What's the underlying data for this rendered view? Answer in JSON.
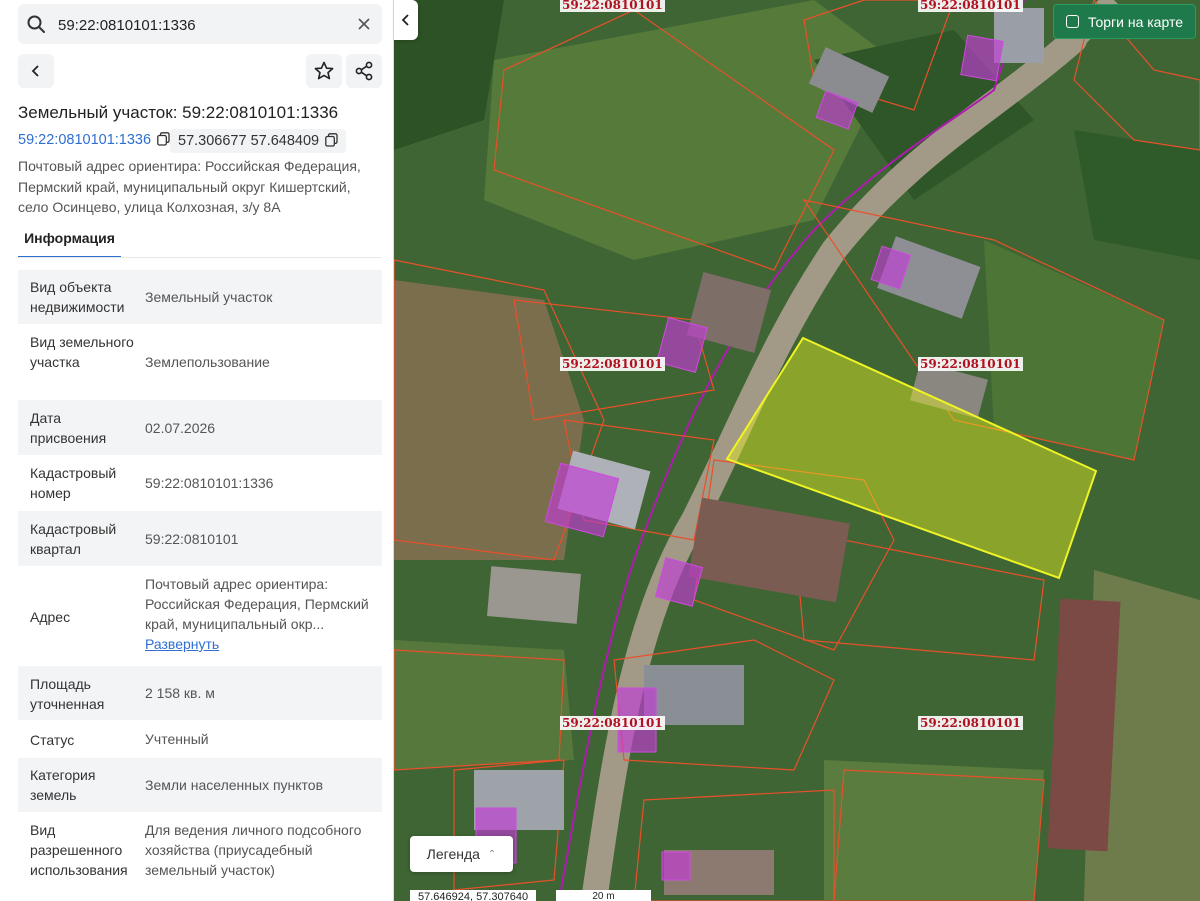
{
  "search": {
    "value": "59:22:0810101:1336"
  },
  "parcel": {
    "title": "Земельный участок: 59:22:0810101:1336",
    "cadastral_number": "59:22:0810101:1336",
    "coordinates": "57.306677 57.648409",
    "address": "Почтовый адрес ориентира: Российская Федерация, Пермский край, муниципальный округ Кишертский, село Осинцево, улица Колхозная, з/у 8А"
  },
  "tabs": [
    {
      "label": "Информация",
      "active": true
    }
  ],
  "info_rows": [
    {
      "label": "Вид объекта недвижимости",
      "value": "Земельный участок"
    },
    {
      "label": "Вид земельного участка",
      "value": "Землепользование"
    },
    {
      "label": "Дата присвоения",
      "value": "02.07.2026"
    },
    {
      "label": "Кадастровый номер",
      "value": "59:22:0810101:1336"
    },
    {
      "label": "Кадастровый квартал",
      "value": "59:22:0810101"
    },
    {
      "label": "Адрес",
      "value": "Почтовый адрес ориентира: Российская Федерация, Пермский край, муниципальный окр...",
      "link": "Развернуть"
    },
    {
      "label": "Площадь уточненная",
      "value": "2 158 кв. м"
    },
    {
      "label": "Статус",
      "value": "Учтенный"
    },
    {
      "label": "Категория земель",
      "value": "Земли населенных пунктов"
    },
    {
      "label": "Вид разрешенного использования",
      "value": "Для ведения личного подсобного хозяйства (приусадебный земельный участок)"
    }
  ],
  "map": {
    "auction_toggle": "Торги на карте",
    "legend_button": "Легенда",
    "coordinate_readout": "57.646924, 57.307640",
    "scale": "20 m",
    "quarter_labels": [
      "59:22:0810101",
      "59:22:0810101",
      "59:22:0810101",
      "59:22:0810101",
      "59:22:0810101",
      "59:22:0810101"
    ]
  },
  "colors": {
    "accent": "#2f6fd0",
    "auction_button": "#1e7a4a",
    "selected_parcel": "#e6f020",
    "parcel_border": "#e8502a",
    "building_highlight": "#c23ad6",
    "quarter_label": "#b01020"
  }
}
